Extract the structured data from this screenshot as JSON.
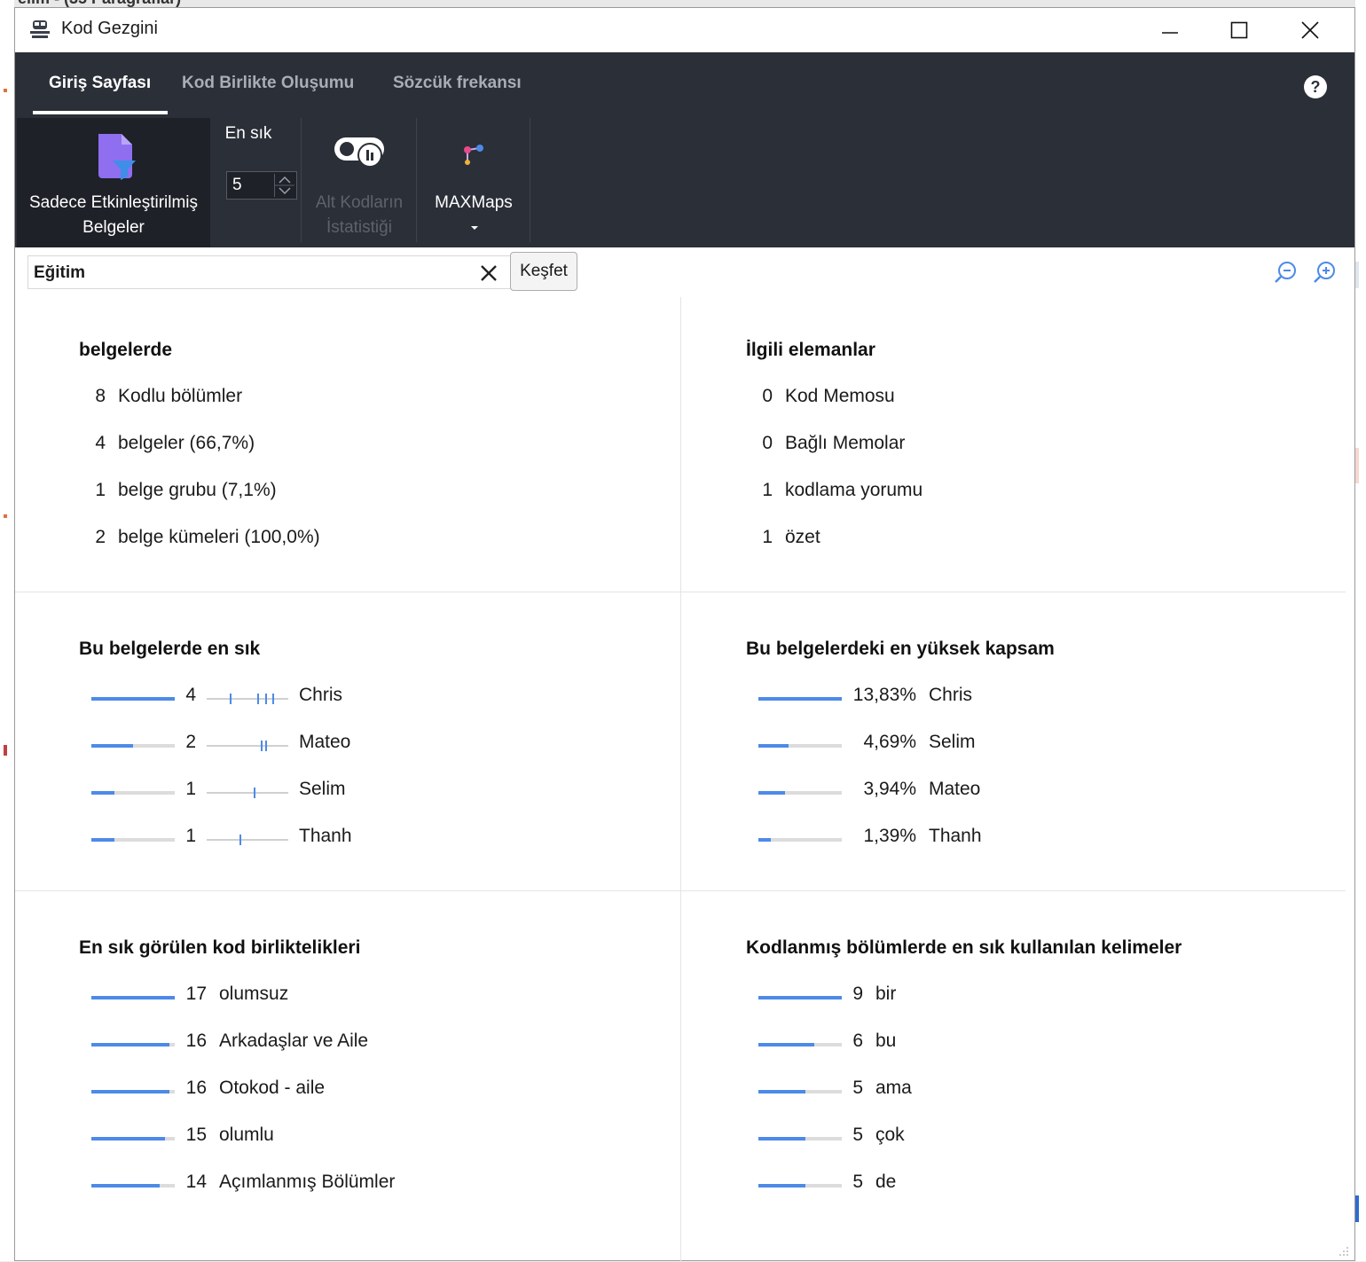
{
  "background": {
    "top_title": "elim - (35 Paragraflar)"
  },
  "window": {
    "title": "Kod Gezgini",
    "controls": [
      "minimize",
      "maximize",
      "close"
    ]
  },
  "ribbon": {
    "tabs": [
      "Giriş Sayfası",
      "Kod Birlikte Oluşumu",
      "Sözcük frekansı"
    ],
    "active_tab": 0,
    "tools": {
      "only_activated": {
        "line1": "Sadece Etkinleştirilmiş",
        "line2": "Belgeler"
      },
      "most_frequent": {
        "label": "En sık",
        "value": "5"
      },
      "subcode_stats": {
        "line1": "Alt Kodların",
        "line2": "İstatistiği",
        "disabled": true
      },
      "maxmaps": {
        "label": "MAXMaps"
      }
    }
  },
  "search": {
    "value": "Eğitim",
    "explore_label": "Keşfet"
  },
  "colors": {
    "accent": "#4d8ae8",
    "ribbon": "#2b2f38"
  },
  "sections": {
    "in_documents": {
      "title": "belgelerde",
      "rows": [
        {
          "num": "8",
          "label": "Kodlu bölümler"
        },
        {
          "num": "4",
          "label": "belgeler (66,7%)"
        },
        {
          "num": "1",
          "label": "belge grubu (7,1%)"
        },
        {
          "num": "2",
          "label": "belge kümeleri (100,0%)"
        }
      ]
    },
    "related": {
      "title": "İlgili elemanlar",
      "rows": [
        {
          "num": "0",
          "label": "Kod Memosu"
        },
        {
          "num": "0",
          "label": "Bağlı Memolar"
        },
        {
          "num": "1",
          "label": "kodlama yorumu"
        },
        {
          "num": "1",
          "label": "özet"
        }
      ]
    },
    "most_frequent": {
      "title": "Bu belgelerde en sık",
      "rows": [
        {
          "num": "4",
          "label": "Chris",
          "fraction": 1.0,
          "ticks": [
            0.28,
            0.62,
            0.72,
            0.8
          ]
        },
        {
          "num": "2",
          "label": "Mateo",
          "fraction": 0.5,
          "ticks": [
            0.66,
            0.72
          ]
        },
        {
          "num": "1",
          "label": "Selim",
          "fraction": 0.28,
          "ticks": [
            0.58
          ]
        },
        {
          "num": "1",
          "label": "Thanh",
          "fraction": 0.28,
          "ticks": [
            0.4
          ]
        }
      ]
    },
    "highest_coverage": {
      "title": "Bu belgelerdeki en yüksek kapsam",
      "rows": [
        {
          "num": "13,83%",
          "label": "Chris",
          "fraction": 1.0
        },
        {
          "num": "4,69%",
          "label": "Selim",
          "fraction": 0.36
        },
        {
          "num": "3,94%",
          "label": "Mateo",
          "fraction": 0.32
        },
        {
          "num": "1,39%",
          "label": "Thanh",
          "fraction": 0.15
        }
      ]
    },
    "cooccurrences": {
      "title": "En sık görülen kod birliktelikleri",
      "rows": [
        {
          "num": "17",
          "label": "olumsuz",
          "fraction": 1.0
        },
        {
          "num": "16",
          "label": "Arkadaşlar ve Aile",
          "fraction": 0.94
        },
        {
          "num": "16",
          "label": "Otokod - aile",
          "fraction": 0.94
        },
        {
          "num": "15",
          "label": "olumlu",
          "fraction": 0.88
        },
        {
          "num": "14",
          "label": "Açımlanmış Bölümler",
          "fraction": 0.82
        }
      ]
    },
    "frequent_words": {
      "title": "Kodlanmış bölümlerde en sık kullanılan kelimeler",
      "rows": [
        {
          "num": "9",
          "label": "bir",
          "fraction": 1.0
        },
        {
          "num": "6",
          "label": "bu",
          "fraction": 0.67
        },
        {
          "num": "5",
          "label": "ama",
          "fraction": 0.56
        },
        {
          "num": "5",
          "label": "çok",
          "fraction": 0.56
        },
        {
          "num": "5",
          "label": "de",
          "fraction": 0.56
        }
      ]
    }
  }
}
